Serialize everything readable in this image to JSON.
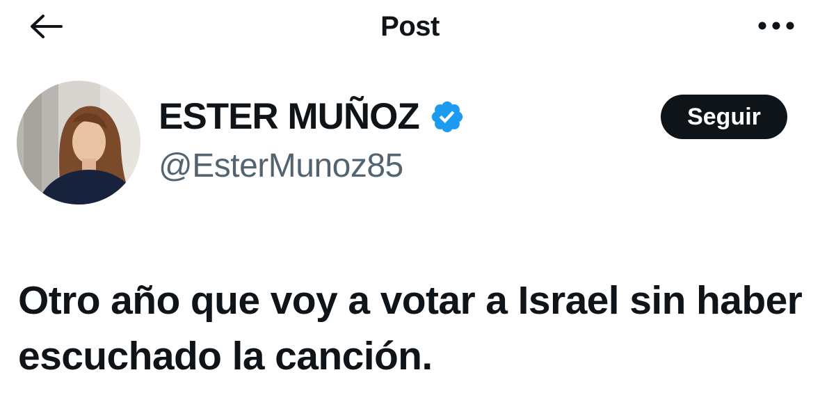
{
  "header": {
    "title": "Post",
    "back_icon": "arrow-left-icon",
    "more_icon": "more-horizontal-icon"
  },
  "author": {
    "display_name": "ESTER MUÑOZ",
    "handle": "@EsterMunoz85",
    "verified": true,
    "verified_color": "#1d9bf0",
    "follow_label": "Seguir"
  },
  "post": {
    "text": "Otro año que voy a votar a Israel sin haber escuchado la canción."
  },
  "colors": {
    "text_primary": "#0f1419",
    "text_secondary": "#536471",
    "button_bg": "#0f1419",
    "button_text": "#ffffff"
  }
}
